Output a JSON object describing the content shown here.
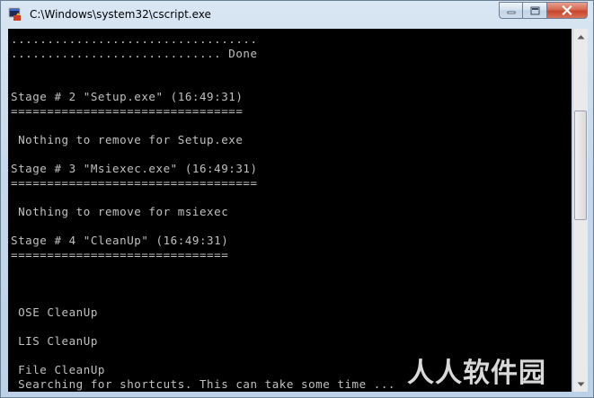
{
  "window": {
    "title": "C:\\Windows\\system32\\cscript.exe",
    "icon": "console-app-icon",
    "buttons": {
      "minimize_icon": "minimize-icon",
      "maximize_icon": "maximize-icon",
      "close_icon": "close-icon"
    }
  },
  "console": {
    "background": "#000000",
    "foreground": "#c0c0c0",
    "lines": [
      "..................................",
      "............................. Done",
      "",
      "",
      "Stage # 2 \"Setup.exe\" (16:49:31)",
      "================================",
      "",
      " Nothing to remove for Setup.exe",
      "",
      "Stage # 3 \"Msiexec.exe\" (16:49:31)",
      "==================================",
      "",
      " Nothing to remove for msiexec",
      "",
      "Stage # 4 \"CleanUp\" (16:49:31)",
      "==============================",
      "",
      "",
      "",
      " OSE CleanUp",
      "",
      " LIS CleanUp",
      "",
      " File CleanUp",
      " Searching for shortcuts. This can take some time ..."
    ]
  },
  "scrollbar": {
    "position_fraction": 0.3,
    "thumb_fraction": 0.33
  },
  "watermark": "人人软件园"
}
